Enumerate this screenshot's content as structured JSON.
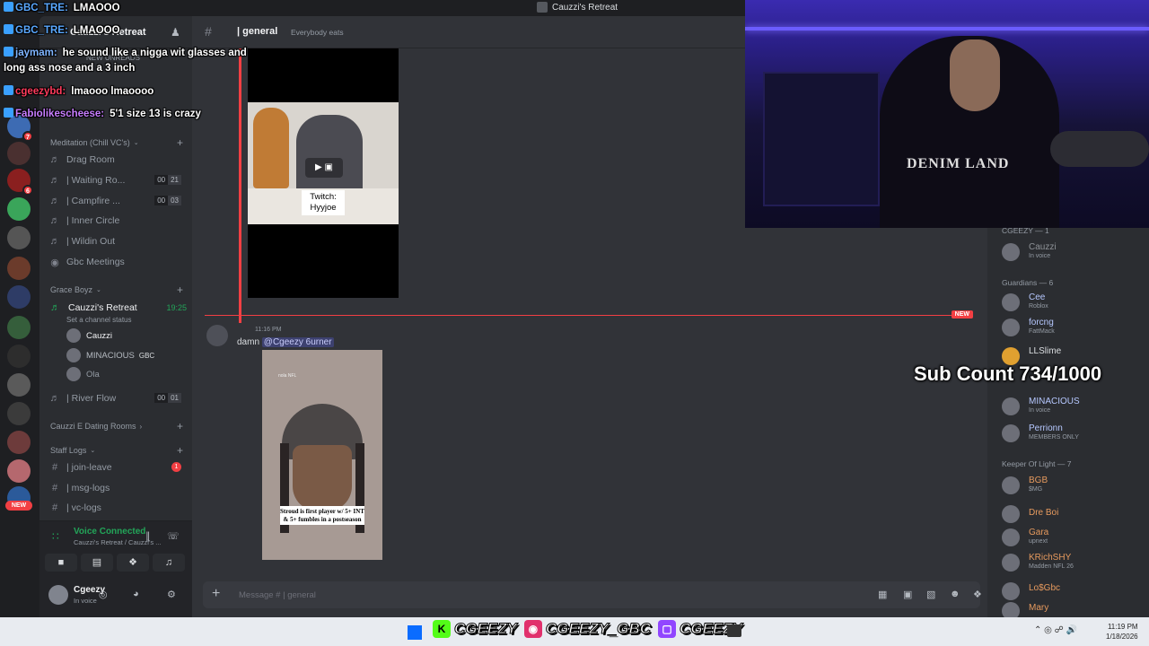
{
  "window": {
    "title": "Cauzzi's Retreat"
  },
  "sidebar": {
    "server_name": "Cauzzi's Retreat",
    "new_unreads": "NEW UNREADS",
    "categories": [
      {
        "label": "Meditation (Chill VC's)"
      },
      {
        "label": "Grace Boyz"
      },
      {
        "label": "Cauzzi E Dating Rooms"
      },
      {
        "label": "Staff Logs"
      }
    ],
    "channels": [
      {
        "label": "Drag Room",
        "count": "",
        "count2": ""
      },
      {
        "label": "| Waiting Ro...",
        "count": "00",
        "count2": "21"
      },
      {
        "label": "| Campfire ...",
        "count": "00",
        "count2": "03"
      },
      {
        "label": "| Inner Circle",
        "count": "",
        "count2": ""
      },
      {
        "label": "| Wildin Out",
        "count": "",
        "count2": ""
      },
      {
        "label": "Gbc Meetings",
        "count": "",
        "count2": ""
      }
    ],
    "active_vc": {
      "label": "Cauzzi's Retreat",
      "status": "Set a channel status",
      "time": "19:25"
    },
    "vc_users": [
      {
        "name": "Cauzzi",
        "color": "#f2f3f5",
        "tag": ""
      },
      {
        "name": "MINACIOUS",
        "color": "#b5bac1",
        "tag": "GBC"
      },
      {
        "name": "Ola",
        "color": "#949ba4",
        "tag": ""
      }
    ],
    "river_flow": {
      "label": "| River Flow",
      "count": "00",
      "count2": "01"
    },
    "staff_channels": [
      {
        "label": "| join-leave",
        "badge": "1"
      },
      {
        "label": "| msg-logs",
        "badge": ""
      },
      {
        "label": "| vc-logs",
        "badge": ""
      }
    ],
    "voice_connected": {
      "label": "Voice Connected",
      "sub": "Cauzzi's Retreat / Cauzzi's ..."
    },
    "user": {
      "name": "Cgeezy",
      "status": "In voice"
    }
  },
  "chat": {
    "channel": "| general",
    "topic": "Everybody eats",
    "video1_label": "Twitch:\nHyyjoe",
    "new_tag": "NEW",
    "message": {
      "time": "11:16 PM",
      "text": "damn ",
      "mention": "@Cgeezy 6urner"
    },
    "video2_caption": "Stroud is first player w/ 5+ INT & 5+ fumbles in a postseason",
    "video2_watermark": "nola NFL",
    "composer_placeholder": "Message # | general"
  },
  "members": {
    "groups": [
      {
        "label": "CGEEZY — 1"
      },
      {
        "label": "Guardians — 6"
      },
      {
        "label": "Keeper Of Light — 7"
      }
    ],
    "list": [
      {
        "name": "Cauzzi",
        "sub": "In voice",
        "color": "#8e9297"
      },
      {
        "name": "Cee",
        "sub": "Roblox",
        "color": "#b6c8ff"
      },
      {
        "name": "forcng",
        "sub": "FattMack",
        "color": "#b6c8ff"
      },
      {
        "name": "LLSlime",
        "sub": "",
        "color": "#dbdee1"
      },
      {
        "name": "MINACIOUS",
        "sub": "In voice",
        "color": "#b6c8ff"
      },
      {
        "name": "Perrionn",
        "sub": "MEMBERS ONLY",
        "color": "#b6c8ff"
      },
      {
        "name": "BGB",
        "sub": "$MG",
        "color": "#e69a5e"
      },
      {
        "name": "Dre Boi",
        "sub": "",
        "color": "#e69a5e"
      },
      {
        "name": "Gara",
        "sub": "upnext",
        "color": "#e69a5e"
      },
      {
        "name": "KRichSHY",
        "sub": "Madden NFL 26",
        "color": "#e69a5e"
      },
      {
        "name": "Lo$Gbc",
        "sub": "",
        "color": "#e69a5e"
      },
      {
        "name": "Mary",
        "sub": "",
        "color": "#e69a5e"
      }
    ]
  },
  "overlay": {
    "sub_count": "Sub Count 734/1000",
    "chat": [
      {
        "user": "GBC_TRE:",
        "text": "LMAOOO",
        "color": "#5aa8ff"
      },
      {
        "user": "GBC_TRE:",
        "text": "LMAOOO",
        "color": "#5aa8ff"
      },
      {
        "user": "jaymam:",
        "text": "he sound like a nigga wit glasses and",
        "color": "#7fb5ff"
      },
      {
        "user": "",
        "text": "long ass nose and a 3 inch",
        "color": "#ffffff"
      },
      {
        "user": "cgeezybd:",
        "text": "lmaooo lmaoooo",
        "color": "#ff3b5c"
      },
      {
        "user": "Fabiolikescheese:",
        "text": "5'1 size 13 is crazy",
        "color": "#c77dff"
      }
    ],
    "handles": [
      {
        "platform": "K",
        "handle": "CGEEZY",
        "color": "#53fc18"
      },
      {
        "platform": "IG",
        "handle": "CGEEZY_GBC",
        "color": "#e1306c"
      },
      {
        "platform": "TW",
        "handle": "CGEEZY",
        "color": "#9146ff"
      }
    ]
  },
  "taskbar": {
    "time": "11:19 PM",
    "date": "1/18/2026"
  }
}
